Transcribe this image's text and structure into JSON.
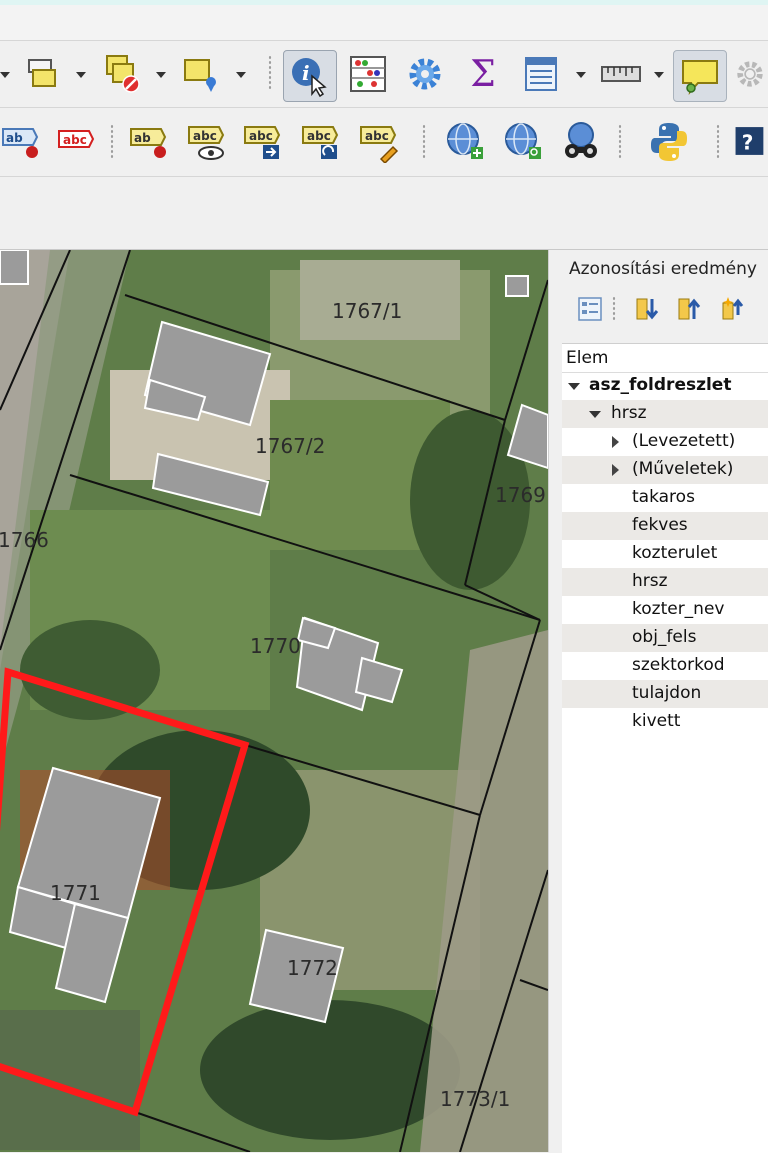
{
  "identify_panel": {
    "title": "Azonosítási eredmény",
    "column_header": "Elem",
    "layer": "asz_foldreszlet",
    "feature": "hrsz",
    "groups": [
      "(Levezetett)",
      "(Műveletek)"
    ],
    "attributes": [
      "takaros",
      "fekves",
      "kozterulet",
      "hrsz",
      "kozter_nev",
      "obj_fels",
      "szektorkod",
      "tulajdon",
      "kivett"
    ]
  },
  "toolbar": {
    "label_icon_text": "abc",
    "label_icon_text_short": "ab",
    "sum_symbol": "Σ",
    "help_symbol": "?"
  },
  "map": {
    "parcel_labels": [
      "1767/1",
      "1767/2",
      "1769",
      "1766",
      "1770",
      "1771",
      "1772",
      "1773/1"
    ],
    "highlight_color": "#ff1a1a"
  }
}
